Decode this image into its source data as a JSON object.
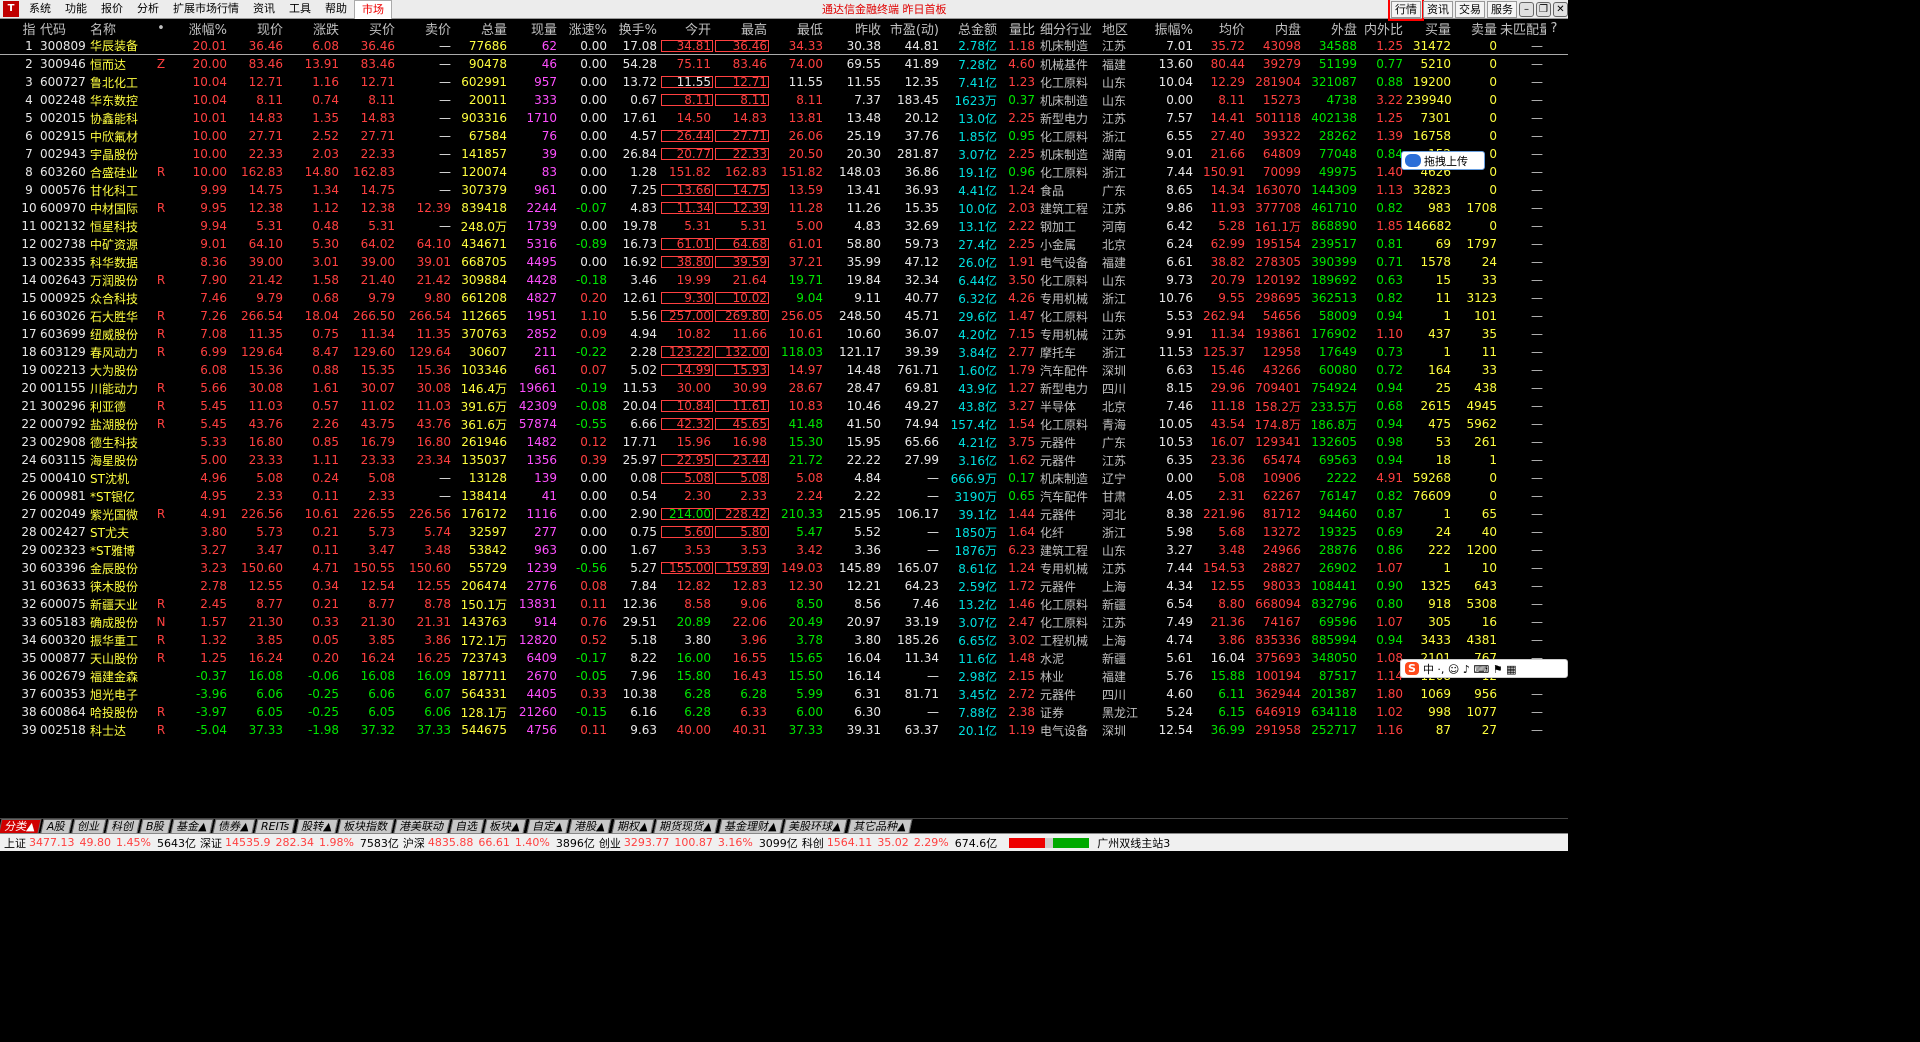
{
  "menu": {
    "logo": "T",
    "items": [
      "系统",
      "功能",
      "报价",
      "分析",
      "扩展市场行情",
      "资讯",
      "工具",
      "帮助"
    ],
    "active": "市场"
  },
  "title": "通达信金融终端 昨日首板",
  "top_buttons": [
    "行情",
    "资讯",
    "交易",
    "服务"
  ],
  "headers": [
    "",
    "指",
    "代码",
    "名称",
    "•",
    "涨幅%",
    "现价",
    "涨跌",
    "买价",
    "卖价",
    "总量",
    "现量",
    "涨速%",
    "换手%",
    "今开",
    "最高",
    "最低",
    "昨收",
    "市盈(动)",
    "总金额",
    "量比",
    "细分行业",
    "地区",
    "振幅%",
    "均价",
    "内盘",
    "外盘",
    "内外比",
    "买量",
    "卖量",
    "未匹配量",
    "?"
  ],
  "rows": [
    [
      "1",
      "300809",
      "华辰装备",
      "",
      "20.01",
      "36.46",
      "6.08",
      "36.46",
      "—",
      "77686",
      "62",
      "0.00",
      "17.08",
      "34.81",
      "36.46",
      "34.33",
      "30.38",
      "44.81",
      "2.78亿",
      "1.18",
      "机床制造",
      "江苏",
      "7.01",
      "35.72",
      "43098",
      "34588",
      "1.25",
      "31472",
      "0",
      "—"
    ],
    [
      "2",
      "300946",
      "恒而达",
      "Z",
      "20.00",
      "83.46",
      "13.91",
      "83.46",
      "—",
      "90478",
      "46",
      "0.00",
      "54.28",
      "75.11",
      "83.46",
      "74.00",
      "69.55",
      "41.89",
      "7.28亿",
      "4.60",
      "机械基件",
      "福建",
      "13.60",
      "80.44",
      "39279",
      "51199",
      "0.77",
      "5210",
      "0",
      "—"
    ],
    [
      "3",
      "600727",
      "鲁北化工",
      "",
      "10.04",
      "12.71",
      "1.16",
      "12.71",
      "—",
      "602991",
      "957",
      "0.00",
      "13.72",
      "11.55",
      "12.71",
      "11.55",
      "11.55",
      "12.35",
      "7.41亿",
      "1.23",
      "化工原料",
      "山东",
      "10.04",
      "12.29",
      "281904",
      "321087",
      "0.88",
      "19200",
      "0",
      "—"
    ],
    [
      "4",
      "002248",
      "华东数控",
      "",
      "10.04",
      "8.11",
      "0.74",
      "8.11",
      "—",
      "20011",
      "333",
      "0.00",
      "0.67",
      "8.11",
      "8.11",
      "8.11",
      "7.37",
      "183.45",
      "1623万",
      "0.37",
      "机床制造",
      "山东",
      "0.00",
      "8.11",
      "15273",
      "4738",
      "3.22",
      "239940",
      "0",
      "—"
    ],
    [
      "5",
      "002015",
      "协鑫能科",
      "",
      "10.01",
      "14.83",
      "1.35",
      "14.83",
      "—",
      "903316",
      "1710",
      "0.00",
      "17.61",
      "14.50",
      "14.83",
      "13.81",
      "13.48",
      "20.12",
      "13.0亿",
      "2.25",
      "新型电力",
      "江苏",
      "7.57",
      "14.41",
      "501118",
      "402138",
      "1.25",
      "7301",
      "0",
      "—"
    ],
    [
      "6",
      "002915",
      "中欣氟材",
      "",
      "10.00",
      "27.71",
      "2.52",
      "27.71",
      "—",
      "67584",
      "76",
      "0.00",
      "4.57",
      "26.44",
      "27.71",
      "26.06",
      "25.19",
      "37.76",
      "1.85亿",
      "0.95",
      "化工原料",
      "浙江",
      "6.55",
      "27.40",
      "39322",
      "28262",
      "1.39",
      "16758",
      "0",
      "—"
    ],
    [
      "7",
      "002943",
      "宇晶股份",
      "",
      "10.00",
      "22.33",
      "2.03",
      "22.33",
      "—",
      "141857",
      "39",
      "0.00",
      "26.84",
      "20.77",
      "22.33",
      "20.50",
      "20.30",
      "281.87",
      "3.07亿",
      "2.25",
      "机床制造",
      "湖南",
      "9.01",
      "21.66",
      "64809",
      "77048",
      "0.84",
      "152",
      "0",
      "—"
    ],
    [
      "8",
      "603260",
      "合盛硅业",
      "R",
      "10.00",
      "162.83",
      "14.80",
      "162.83",
      "—",
      "120074",
      "83",
      "0.00",
      "1.28",
      "151.82",
      "162.83",
      "151.82",
      "148.03",
      "36.86",
      "19.1亿",
      "0.96",
      "化工原料",
      "浙江",
      "7.44",
      "150.91",
      "70099",
      "49975",
      "1.40",
      "4626",
      "0",
      "—"
    ],
    [
      "9",
      "000576",
      "甘化科工",
      "",
      "9.99",
      "14.75",
      "1.34",
      "14.75",
      "—",
      "307379",
      "961",
      "0.00",
      "7.25",
      "13.66",
      "14.75",
      "13.59",
      "13.41",
      "36.93",
      "4.41亿",
      "1.24",
      "食品",
      "广东",
      "8.65",
      "14.34",
      "163070",
      "144309",
      "1.13",
      "32823",
      "0",
      "—"
    ],
    [
      "10",
      "600970",
      "中材国际",
      "R",
      "9.95",
      "12.38",
      "1.12",
      "12.38",
      "12.39",
      "839418",
      "2244",
      "-0.07",
      "4.83",
      "11.34",
      "12.39",
      "11.28",
      "11.26",
      "15.35",
      "10.0亿",
      "2.03",
      "建筑工程",
      "江苏",
      "9.86",
      "11.93",
      "377708",
      "461710",
      "0.82",
      "983",
      "1708",
      "—"
    ],
    [
      "11",
      "002132",
      "恒星科技",
      "",
      "9.94",
      "5.31",
      "0.48",
      "5.31",
      "—",
      "248.0万",
      "1739",
      "0.00",
      "19.78",
      "5.31",
      "5.31",
      "5.00",
      "4.83",
      "32.69",
      "13.1亿",
      "2.22",
      "钢加工",
      "河南",
      "6.42",
      "5.28",
      "161.1万",
      "868890",
      "1.85",
      "146682",
      "0",
      "—"
    ],
    [
      "12",
      "002738",
      "中矿资源",
      "",
      "9.01",
      "64.10",
      "5.30",
      "64.02",
      "64.10",
      "434671",
      "5316",
      "-0.89",
      "16.73",
      "61.01",
      "64.68",
      "61.01",
      "58.80",
      "59.73",
      "27.4亿",
      "2.25",
      "小金属",
      "北京",
      "6.24",
      "62.99",
      "195154",
      "239517",
      "0.81",
      "69",
      "1797",
      "—"
    ],
    [
      "13",
      "002335",
      "科华数据",
      "",
      "8.36",
      "39.00",
      "3.01",
      "39.00",
      "39.01",
      "668705",
      "4495",
      "0.00",
      "16.92",
      "38.80",
      "39.59",
      "37.21",
      "35.99",
      "47.12",
      "26.0亿",
      "1.91",
      "电气设备",
      "福建",
      "6.61",
      "38.82",
      "278305",
      "390399",
      "0.71",
      "1578",
      "24",
      "—"
    ],
    [
      "14",
      "002643",
      "万润股份",
      "R",
      "7.90",
      "21.42",
      "1.58",
      "21.40",
      "21.42",
      "309884",
      "4428",
      "-0.18",
      "3.46",
      "19.99",
      "21.64",
      "19.71",
      "19.84",
      "32.34",
      "6.44亿",
      "3.50",
      "化工原料",
      "山东",
      "9.73",
      "20.79",
      "120192",
      "189692",
      "0.63",
      "15",
      "33",
      "—"
    ],
    [
      "15",
      "000925",
      "众合科技",
      "",
      "7.46",
      "9.79",
      "0.68",
      "9.79",
      "9.80",
      "661208",
      "4827",
      "0.20",
      "12.61",
      "9.30",
      "10.02",
      "9.04",
      "9.11",
      "40.77",
      "6.32亿",
      "4.26",
      "专用机械",
      "浙江",
      "10.76",
      "9.55",
      "298695",
      "362513",
      "0.82",
      "11",
      "3123",
      "—"
    ],
    [
      "16",
      "603026",
      "石大胜华",
      "R",
      "7.26",
      "266.54",
      "18.04",
      "266.50",
      "266.54",
      "112665",
      "1951",
      "1.10",
      "5.56",
      "257.00",
      "269.80",
      "256.05",
      "248.50",
      "45.71",
      "29.6亿",
      "1.47",
      "化工原料",
      "山东",
      "5.53",
      "262.94",
      "54656",
      "58009",
      "0.94",
      "1",
      "101",
      "—"
    ],
    [
      "17",
      "603699",
      "纽威股份",
      "R",
      "7.08",
      "11.35",
      "0.75",
      "11.34",
      "11.35",
      "370763",
      "2852",
      "0.09",
      "4.94",
      "10.82",
      "11.66",
      "10.61",
      "10.60",
      "36.07",
      "4.20亿",
      "7.15",
      "专用机械",
      "江苏",
      "9.91",
      "11.34",
      "193861",
      "176902",
      "1.10",
      "437",
      "35",
      "—"
    ],
    [
      "18",
      "603129",
      "春风动力",
      "R",
      "6.99",
      "129.64",
      "8.47",
      "129.60",
      "129.64",
      "30607",
      "211",
      "-0.22",
      "2.28",
      "123.22",
      "132.00",
      "118.03",
      "121.17",
      "39.39",
      "3.84亿",
      "2.77",
      "摩托车",
      "浙江",
      "11.53",
      "125.37",
      "12958",
      "17649",
      "0.73",
      "1",
      "11",
      "—"
    ],
    [
      "19",
      "002213",
      "大为股份",
      "",
      "6.08",
      "15.36",
      "0.88",
      "15.35",
      "15.36",
      "103346",
      "661",
      "0.07",
      "5.02",
      "14.99",
      "15.93",
      "14.97",
      "14.48",
      "761.71",
      "1.60亿",
      "1.79",
      "汽车配件",
      "深圳",
      "6.63",
      "15.46",
      "43266",
      "60080",
      "0.72",
      "164",
      "33",
      "—"
    ],
    [
      "20",
      "001155",
      "川能动力",
      "R",
      "5.66",
      "30.08",
      "1.61",
      "30.07",
      "30.08",
      "146.4万",
      "19661",
      "-0.19",
      "11.53",
      "30.00",
      "30.99",
      "28.67",
      "28.47",
      "69.81",
      "43.9亿",
      "1.27",
      "新型电力",
      "四川",
      "8.15",
      "29.96",
      "709401",
      "754924",
      "0.94",
      "25",
      "438",
      "—"
    ],
    [
      "21",
      "300296",
      "利亚德",
      "R",
      "5.45",
      "11.03",
      "0.57",
      "11.02",
      "11.03",
      "391.6万",
      "42309",
      "-0.08",
      "20.04",
      "10.84",
      "11.61",
      "10.83",
      "10.46",
      "49.27",
      "43.8亿",
      "3.27",
      "半导体",
      "北京",
      "7.46",
      "11.18",
      "158.2万",
      "233.5万",
      "0.68",
      "2615",
      "4945",
      "—"
    ],
    [
      "22",
      "000792",
      "盐湖股份",
      "R",
      "5.45",
      "43.76",
      "2.26",
      "43.75",
      "43.76",
      "361.6万",
      "57874",
      "-0.55",
      "6.66",
      "42.32",
      "45.65",
      "41.48",
      "41.50",
      "74.94",
      "157.4亿",
      "1.54",
      "化工原料",
      "青海",
      "10.05",
      "43.54",
      "174.8万",
      "186.8万",
      "0.94",
      "475",
      "5962",
      "—"
    ],
    [
      "23",
      "002908",
      "德生科技",
      "",
      "5.33",
      "16.80",
      "0.85",
      "16.79",
      "16.80",
      "261946",
      "1482",
      "0.12",
      "17.71",
      "15.96",
      "16.98",
      "15.30",
      "15.95",
      "65.66",
      "4.21亿",
      "3.75",
      "元器件",
      "广东",
      "10.53",
      "16.07",
      "129341",
      "132605",
      "0.98",
      "53",
      "261",
      "—"
    ],
    [
      "24",
      "603115",
      "海星股份",
      "",
      "5.00",
      "23.33",
      "1.11",
      "23.33",
      "23.34",
      "135037",
      "1356",
      "0.39",
      "25.97",
      "22.95",
      "23.44",
      "21.72",
      "22.22",
      "27.99",
      "3.16亿",
      "1.62",
      "元器件",
      "江苏",
      "6.35",
      "23.36",
      "65474",
      "69563",
      "0.94",
      "18",
      "1",
      "—"
    ],
    [
      "25",
      "000410",
      "ST沈机",
      "",
      "4.96",
      "5.08",
      "0.24",
      "5.08",
      "—",
      "13128",
      "139",
      "0.00",
      "0.08",
      "5.08",
      "5.08",
      "5.08",
      "4.84",
      "—",
      "666.9万",
      "0.17",
      "机床制造",
      "辽宁",
      "0.00",
      "5.08",
      "10906",
      "2222",
      "4.91",
      "59268",
      "0",
      "—"
    ],
    [
      "26",
      "000981",
      "*ST银亿",
      "",
      "4.95",
      "2.33",
      "0.11",
      "2.33",
      "—",
      "138414",
      "41",
      "0.00",
      "0.54",
      "2.30",
      "2.33",
      "2.24",
      "2.22",
      "—",
      "3190万",
      "0.65",
      "汽车配件",
      "甘肃",
      "4.05",
      "2.31",
      "62267",
      "76147",
      "0.82",
      "76609",
      "0",
      "—"
    ],
    [
      "27",
      "002049",
      "紫光国微",
      "R",
      "4.91",
      "226.56",
      "10.61",
      "226.55",
      "226.56",
      "176172",
      "1116",
      "0.00",
      "2.90",
      "214.00",
      "228.42",
      "210.33",
      "215.95",
      "106.17",
      "39.1亿",
      "1.44",
      "元器件",
      "河北",
      "8.38",
      "221.96",
      "81712",
      "94460",
      "0.87",
      "1",
      "65",
      "—"
    ],
    [
      "28",
      "002427",
      "ST尤夫",
      "",
      "3.80",
      "5.73",
      "0.21",
      "5.73",
      "5.74",
      "32597",
      "277",
      "0.00",
      "0.75",
      "5.60",
      "5.80",
      "5.47",
      "5.52",
      "—",
      "1850万",
      "1.64",
      "化纤",
      "浙江",
      "5.98",
      "5.68",
      "13272",
      "19325",
      "0.69",
      "24",
      "40",
      "—"
    ],
    [
      "29",
      "002323",
      "*ST雅博",
      "",
      "3.27",
      "3.47",
      "0.11",
      "3.47",
      "3.48",
      "53842",
      "963",
      "0.00",
      "1.67",
      "3.53",
      "3.53",
      "3.42",
      "3.36",
      "—",
      "1876万",
      "6.23",
      "建筑工程",
      "山东",
      "3.27",
      "3.48",
      "24966",
      "28876",
      "0.86",
      "222",
      "1200",
      "—"
    ],
    [
      "30",
      "603396",
      "金辰股份",
      "",
      "3.23",
      "150.60",
      "4.71",
      "150.55",
      "150.60",
      "55729",
      "1239",
      "-0.56",
      "5.27",
      "155.00",
      "159.89",
      "149.03",
      "145.89",
      "165.07",
      "8.61亿",
      "1.24",
      "专用机械",
      "江苏",
      "7.44",
      "154.53",
      "28827",
      "26902",
      "1.07",
      "1",
      "10",
      "—"
    ],
    [
      "31",
      "603633",
      "徕木股份",
      "",
      "2.78",
      "12.55",
      "0.34",
      "12.54",
      "12.55",
      "206474",
      "2776",
      "0.08",
      "7.84",
      "12.82",
      "12.83",
      "12.30",
      "12.21",
      "64.23",
      "2.59亿",
      "1.72",
      "元器件",
      "上海",
      "4.34",
      "12.55",
      "98033",
      "108441",
      "0.90",
      "1325",
      "643",
      "—"
    ],
    [
      "32",
      "600075",
      "新疆天业",
      "R",
      "2.45",
      "8.77",
      "0.21",
      "8.77",
      "8.78",
      "150.1万",
      "13831",
      "0.11",
      "12.36",
      "8.58",
      "9.06",
      "8.50",
      "8.56",
      "7.46",
      "13.2亿",
      "1.46",
      "化工原料",
      "新疆",
      "6.54",
      "8.80",
      "668094",
      "832796",
      "0.80",
      "918",
      "5308",
      "—"
    ],
    [
      "33",
      "605183",
      "确成股份",
      "N",
      "1.57",
      "21.30",
      "0.33",
      "21.30",
      "21.31",
      "143763",
      "914",
      "0.76",
      "29.51",
      "20.89",
      "22.06",
      "20.49",
      "20.97",
      "33.19",
      "3.07亿",
      "2.47",
      "化工原料",
      "江苏",
      "7.49",
      "21.36",
      "74167",
      "69596",
      "1.07",
      "305",
      "16",
      "—"
    ],
    [
      "34",
      "600320",
      "振华重工",
      "R",
      "1.32",
      "3.85",
      "0.05",
      "3.85",
      "3.86",
      "172.1万",
      "12820",
      "0.52",
      "5.18",
      "3.80",
      "3.96",
      "3.78",
      "3.80",
      "185.26",
      "6.65亿",
      "3.02",
      "工程机械",
      "上海",
      "4.74",
      "3.86",
      "835336",
      "885994",
      "0.94",
      "3433",
      "4381",
      "—"
    ],
    [
      "35",
      "000877",
      "天山股份",
      "R",
      "1.25",
      "16.24",
      "0.20",
      "16.24",
      "16.25",
      "723743",
      "6409",
      "-0.17",
      "8.22",
      "16.00",
      "16.55",
      "15.65",
      "16.04",
      "11.34",
      "11.6亿",
      "1.48",
      "水泥",
      "新疆",
      "5.61",
      "16.04",
      "375693",
      "348050",
      "1.08",
      "2101",
      "767",
      "—"
    ],
    [
      "36",
      "002679",
      "福建金森",
      "",
      "-0.37",
      "16.08",
      "-0.06",
      "16.08",
      "16.09",
      "187711",
      "2670",
      "-0.05",
      "7.96",
      "15.80",
      "16.43",
      "15.50",
      "16.14",
      "—",
      "2.98亿",
      "2.15",
      "林业",
      "福建",
      "5.76",
      "15.88",
      "100194",
      "87517",
      "1.14",
      "1208",
      "12",
      "—"
    ],
    [
      "37",
      "600353",
      "旭光电子",
      "",
      "-3.96",
      "6.06",
      "-0.25",
      "6.06",
      "6.07",
      "564331",
      "4405",
      "0.33",
      "10.38",
      "6.28",
      "6.28",
      "5.99",
      "6.31",
      "81.71",
      "3.45亿",
      "2.72",
      "元器件",
      "四川",
      "4.60",
      "6.11",
      "362944",
      "201387",
      "1.80",
      "1069",
      "956",
      "—"
    ],
    [
      "38",
      "600864",
      "哈投股份",
      "R",
      "-3.97",
      "6.05",
      "-0.25",
      "6.05",
      "6.06",
      "128.1万",
      "21260",
      "-0.15",
      "6.16",
      "6.28",
      "6.33",
      "6.00",
      "6.30",
      "—",
      "7.88亿",
      "2.38",
      "证券",
      "黑龙江",
      "5.24",
      "6.15",
      "646919",
      "634118",
      "1.02",
      "998",
      "1077",
      "—"
    ],
    [
      "39",
      "002518",
      "科士达",
      "R",
      "-5.04",
      "37.33",
      "-1.98",
      "37.32",
      "37.33",
      "544675",
      "4756",
      "0.11",
      "9.63",
      "40.00",
      "40.31",
      "37.33",
      "39.31",
      "63.37",
      "20.1亿",
      "1.19",
      "电气设备",
      "深圳",
      "12.54",
      "36.99",
      "291958",
      "252717",
      "1.16",
      "87",
      "27",
      "—"
    ]
  ],
  "upload_label": "拖拽上传",
  "ime_text": "中 ·, ☺ ♪ ⌨ ⚑ ▦",
  "tabs": [
    "分类▲",
    "A股",
    "创业",
    "科创",
    "B股",
    "基金▲",
    "债券▲",
    "REITs",
    "股转▲",
    "板块指数",
    "港美联动",
    "自选",
    "板块▲",
    "自定▲",
    "港股▲",
    "期权▲",
    "期货现货▲",
    "基金理财▲",
    "美股环球▲",
    "其它品种▲"
  ],
  "status": [
    {
      "name": "上证",
      "val": "3477.13",
      "chg": "49.80",
      "pct": "1.45%",
      "amt": "5643亿"
    },
    {
      "name": "深证",
      "val": "14535.9",
      "chg": "282.34",
      "pct": "1.98%",
      "amt": "7583亿"
    },
    {
      "name": "沪深",
      "val": "4835.88",
      "chg": "66.61",
      "pct": "1.40%",
      "amt": "3896亿"
    },
    {
      "name": "创业",
      "val": "3293.77",
      "chg": "100.87",
      "pct": "3.16%",
      "amt": "3099亿"
    },
    {
      "name": "科创",
      "val": "1564.11",
      "chg": "35.02",
      "pct": "2.29%",
      "amt": "674.6亿"
    }
  ],
  "server": "广州双线主站3",
  "colors": {
    "up": "#ff4040",
    "down": "#00e600",
    "neutral": "#e8e8e8",
    "volume": "#ffff40",
    "industry": "#c0c0c0",
    "active_tab": "#d00000"
  }
}
